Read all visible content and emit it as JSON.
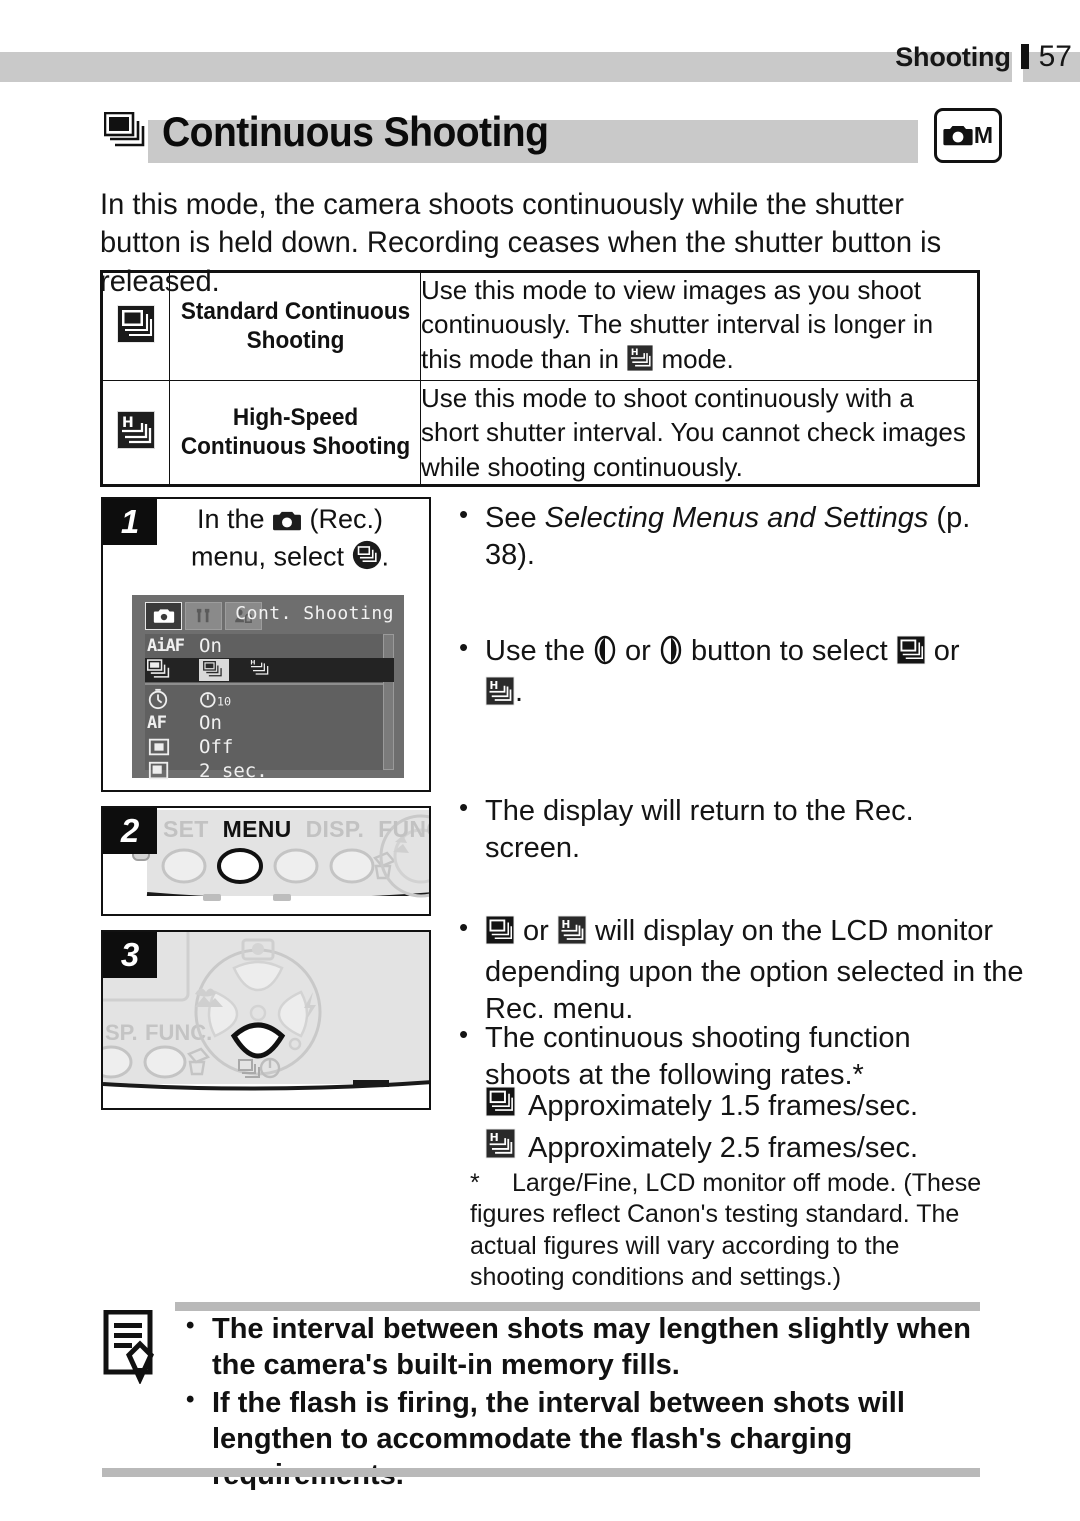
{
  "runhead": {
    "section": "Shooting",
    "page_number": "57"
  },
  "title": {
    "text": "Continuous Shooting",
    "icon": "continuous-shooting-icon",
    "mode_badge": {
      "icon": "camera-icon",
      "label": "M"
    }
  },
  "intro": "In this mode, the camera shoots continuously while the shutter button is held down. Recording ceases when the shutter button is released.",
  "modes_table": {
    "rows": [
      {
        "icon": "standard-continuous-icon",
        "name": "Standard Continuous Shooting",
        "description_pre": "Use this mode to view images as you shoot continuously. The shutter interval is longer in this mode than in ",
        "description_post": " mode.",
        "inline_icon": "high-speed-continuous-icon"
      },
      {
        "icon": "high-speed-continuous-icon",
        "name": "High-Speed Continuous Shooting",
        "description_pre": "Use this mode to shoot continuously with a short shutter interval. You cannot check images while shooting continuously.",
        "description_post": "",
        "inline_icon": ""
      }
    ]
  },
  "steps": [
    {
      "number": "1",
      "caption_line1_pre": "In the ",
      "caption_line1_post": " (Rec.)",
      "caption_line2_pre": "menu, select ",
      "caption_line2_post": ".",
      "caption_icon1": "camera-icon",
      "caption_icon2": "continuous-shooting-round-icon",
      "lcd": {
        "title": "Cont. Shooting",
        "tabs": [
          "rec-tab-icon",
          "setup-tab-icon",
          "mysetup-tab-icon"
        ],
        "rows": [
          {
            "label_icon": "aiaf-icon",
            "label_text": "AiAF",
            "value": "On"
          },
          {
            "label_icon": "continuous-shooting-icon",
            "label_text": "",
            "value": "",
            "selected": true,
            "options": [
              "standard-continuous-icon",
              "high-speed-continuous-icon"
            ]
          },
          {
            "label_icon": "self-timer-icon",
            "label_text": "",
            "value_icon": "self-timer-10sec-icon",
            "value": ""
          },
          {
            "label_icon": "af-assist-icon",
            "label_text": "AF",
            "value": "On"
          },
          {
            "label_icon": "digital-zoom-icon",
            "label_text": "",
            "value": "Off"
          },
          {
            "label_icon": "review-icon",
            "label_text": "",
            "value": "2 sec."
          }
        ]
      }
    },
    {
      "number": "2",
      "buttons": [
        {
          "label": "SET",
          "active": false
        },
        {
          "label": "MENU",
          "active": true
        },
        {
          "label": "DISP.",
          "active": false
        },
        {
          "label": "FUNC.",
          "active": false
        }
      ]
    },
    {
      "number": "3"
    }
  ],
  "notes": [
    {
      "id": "see-selecting-menus",
      "pre": "See ",
      "italic": "Selecting Menus and Settings",
      "post": " (p. 38)."
    },
    {
      "id": "use-button-to-select",
      "pre": "Use the ",
      "mid1": " or ",
      "mid2": " button to select ",
      "mid3": " or",
      "post": "."
    },
    {
      "id": "display-returns",
      "text": "The display will return to the Rec. screen."
    },
    {
      "id": "icon-will-display",
      "pre": "",
      "mid": " or ",
      "post": " will display on the LCD monitor depending upon the option selected in the Rec. menu."
    },
    {
      "id": "shooting-rates",
      "text": "The continuous shooting function shoots at the following rates.*"
    }
  ],
  "rates": [
    {
      "icon": "standard-continuous-icon",
      "text": "Approximately 1.5 frames/sec."
    },
    {
      "icon": "high-speed-continuous-icon",
      "text": "Approximately 2.5 frames/sec."
    }
  ],
  "footnote": {
    "marker": "*",
    "text": "Large/Fine, LCD monitor off mode. (These figures reflect Canon's testing standard. The actual figures will vary according to the shooting conditions and settings.)"
  },
  "memo": {
    "icon": "memo-note-icon",
    "bullets": [
      "The interval between shots may lengthen slightly when the camera's built-in memory fills.",
      "If the flash is firing, the interval between shots will lengthen to accommodate the flash's charging requirements."
    ]
  },
  "colors": {
    "gray_bar": "#c9c9c9",
    "memo_bar": "#b9b9b9",
    "text": "#141414",
    "lcd_bg": "#6e6e6e",
    "lcd_selected": "#232323"
  }
}
